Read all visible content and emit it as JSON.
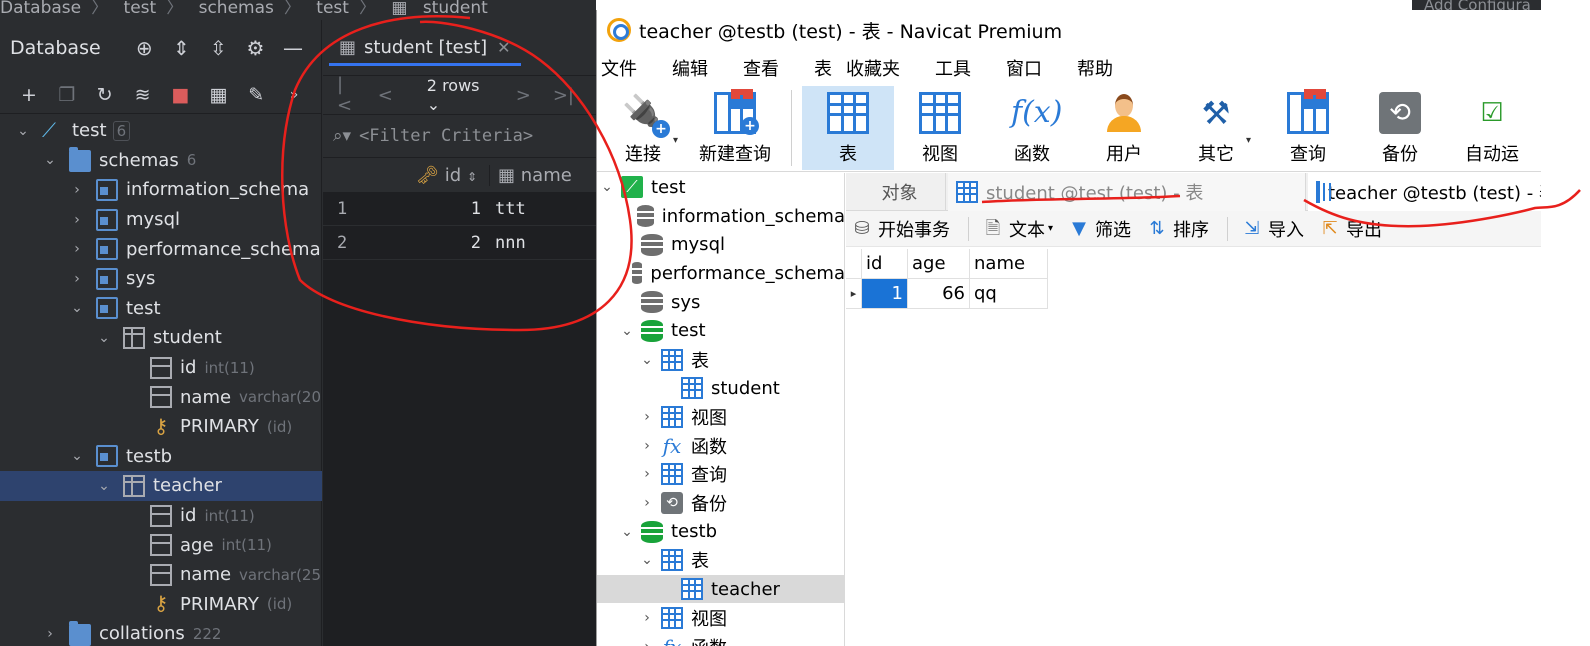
{
  "ide": {
    "breadcrumbs": [
      "Database",
      "test",
      "schemas",
      "test",
      "student"
    ],
    "top_right": "Add Configura",
    "panel_title": "Database",
    "tree": [
      {
        "label": "test",
        "meta": "6",
        "meta_kind": "badge",
        "icon": "connection-icon",
        "depth": 0,
        "chev": "⌄"
      },
      {
        "label": "schemas",
        "meta": "6",
        "icon": "folder-icon",
        "depth": 1,
        "chev": "⌄"
      },
      {
        "label": "information_schema",
        "icon": "schema-icon",
        "depth": 2,
        "chev": "›"
      },
      {
        "label": "mysql",
        "icon": "schema-icon",
        "depth": 2,
        "chev": "›"
      },
      {
        "label": "performance_schema",
        "icon": "schema-icon",
        "depth": 2,
        "chev": "›"
      },
      {
        "label": "sys",
        "icon": "schema-icon",
        "depth": 2,
        "chev": "›"
      },
      {
        "label": "test",
        "icon": "schema-icon",
        "depth": 2,
        "chev": "⌄"
      },
      {
        "label": "student",
        "icon": "table-icon",
        "depth": 3,
        "chev": "⌄"
      },
      {
        "label": "id",
        "meta": "int(11)",
        "icon": "primary-key-column-icon",
        "depth": 4,
        "chev": ""
      },
      {
        "label": "name",
        "meta": "varchar(20",
        "icon": "column-icon",
        "depth": 4,
        "chev": ""
      },
      {
        "label": "PRIMARY",
        "meta": "(id)",
        "icon": "key-icon",
        "depth": 4,
        "chev": ""
      },
      {
        "label": "testb",
        "icon": "schema-icon",
        "depth": 2,
        "chev": "⌄"
      },
      {
        "label": "teacher",
        "icon": "table-icon",
        "depth": 3,
        "chev": "⌄",
        "selected": true
      },
      {
        "label": "id",
        "meta": "int(11)",
        "icon": "primary-key-column-icon",
        "depth": 4,
        "chev": ""
      },
      {
        "label": "age",
        "meta": "int(11)",
        "icon": "column-icon",
        "depth": 4,
        "chev": ""
      },
      {
        "label": "name",
        "meta": "varchar(25",
        "icon": "column-icon",
        "depth": 4,
        "chev": ""
      },
      {
        "label": "PRIMARY",
        "meta": "(id)",
        "icon": "key-icon",
        "depth": 4,
        "chev": ""
      },
      {
        "label": "collations",
        "meta": "222",
        "icon": "folder-icon",
        "depth": 1,
        "chev": "›"
      }
    ],
    "editor": {
      "tab_label": "student [test]",
      "rows_label": "2 rows",
      "filter_placeholder": "<Filter Criteria>",
      "columns": [
        "id",
        "name"
      ],
      "rows": [
        {
          "num": "1",
          "id": "1",
          "name": "ttt"
        },
        {
          "num": "2",
          "id": "2",
          "name": "nnn"
        }
      ]
    }
  },
  "navicat": {
    "title": "teacher @testb (test) - 表 - Navicat Premium",
    "menu": [
      "文件",
      "编辑",
      "查看",
      "表",
      "收藏夹",
      "工具",
      "窗口",
      "帮助"
    ],
    "toolbar": [
      {
        "label": "连接",
        "icon": "plug-icon"
      },
      {
        "label": "新建查询",
        "icon": "new-query-icon"
      },
      {
        "label": "表",
        "icon": "table-icon",
        "active": true
      },
      {
        "label": "视图",
        "icon": "view-icon"
      },
      {
        "label": "函数",
        "icon": "function-icon"
      },
      {
        "label": "用户",
        "icon": "user-icon"
      },
      {
        "label": "其它",
        "icon": "tools-icon"
      },
      {
        "label": "查询",
        "icon": "query-icon"
      },
      {
        "label": "备份",
        "icon": "backup-icon"
      },
      {
        "label": "自动运",
        "icon": "automation-icon"
      }
    ],
    "tree": [
      {
        "label": "test",
        "icon": "connection-icon",
        "depth": 0,
        "chev": "⌄"
      },
      {
        "label": "information_schema",
        "icon": "database-gray-icon",
        "depth": 1,
        "chev": ""
      },
      {
        "label": "mysql",
        "icon": "database-gray-icon",
        "depth": 1,
        "chev": ""
      },
      {
        "label": "performance_schema",
        "icon": "database-gray-icon",
        "depth": 1,
        "chev": ""
      },
      {
        "label": "sys",
        "icon": "database-gray-icon",
        "depth": 1,
        "chev": ""
      },
      {
        "label": "test",
        "icon": "database-green-icon",
        "depth": 1,
        "chev": "⌄"
      },
      {
        "label": "表",
        "icon": "tables-icon",
        "depth": 2,
        "chev": "⌄"
      },
      {
        "label": "student",
        "icon": "table-icon",
        "depth": 3,
        "chev": ""
      },
      {
        "label": "视图",
        "icon": "views-icon",
        "depth": 2,
        "chev": "›"
      },
      {
        "label": "函数",
        "icon": "function-icon",
        "depth": 2,
        "chev": "›"
      },
      {
        "label": "查询",
        "icon": "query-icon",
        "depth": 2,
        "chev": "›"
      },
      {
        "label": "备份",
        "icon": "backup-icon",
        "depth": 2,
        "chev": "›"
      },
      {
        "label": "testb",
        "icon": "database-green-icon",
        "depth": 1,
        "chev": "⌄"
      },
      {
        "label": "表",
        "icon": "tables-icon",
        "depth": 2,
        "chev": "⌄"
      },
      {
        "label": "teacher",
        "icon": "table-icon",
        "depth": 3,
        "chev": "",
        "selected": true
      },
      {
        "label": "视图",
        "icon": "views-icon",
        "depth": 2,
        "chev": "›"
      },
      {
        "label": "函数",
        "icon": "function-icon",
        "depth": 2,
        "chev": "›"
      }
    ],
    "tabs": {
      "objects": "对象",
      "tab1": "student @test (test) - 表",
      "tab2": "teacher @testb (test) - 表"
    },
    "actions": {
      "begin_transaction": "开始事务",
      "text": "文本",
      "filter": "筛选",
      "sort": "排序",
      "import": "导入",
      "export": "导出"
    },
    "grid": {
      "columns": [
        "id",
        "age",
        "name"
      ],
      "rows": [
        {
          "id": "1",
          "age": "66",
          "name": "qq"
        }
      ]
    }
  },
  "colors": {
    "annotation": "#e8201c",
    "ide_bg": "#2b2d30",
    "selection_blue": "#1a73d6"
  }
}
